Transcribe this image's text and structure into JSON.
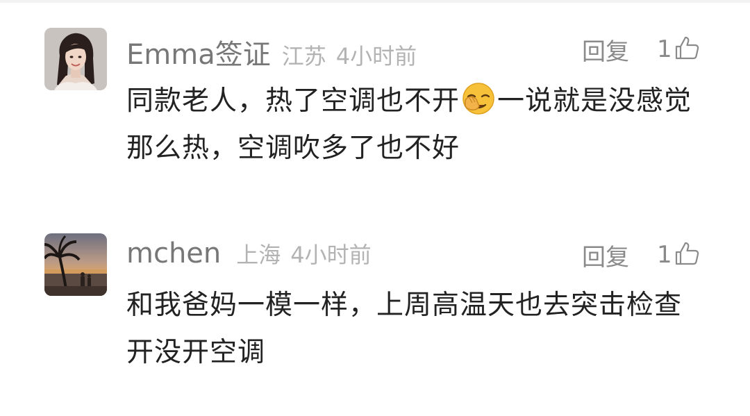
{
  "comments": [
    {
      "username": "Emma签证",
      "location": "江苏",
      "time": "4小时前",
      "reply_label": "回复",
      "likes": "1",
      "text_before_emoji": "同款老人，热了空调也不开",
      "emoji_icon": "face-palm-emoji-icon",
      "text_after_emoji": "一说就是没感觉那么热，空调吹多了也不好"
    },
    {
      "username": "mchen",
      "location": "上海",
      "time": "4小时前",
      "reply_label": "回复",
      "likes": "1",
      "text": "和我爸妈一模一样，上周高温天也去突击检查开没开空调"
    }
  ],
  "icons": {
    "like": "thumbs-up-icon",
    "avatar_1": "woman-portrait-avatar",
    "avatar_2": "palm-tree-sunset-avatar"
  },
  "colors": {
    "username": "#777777",
    "meta": "#b3b3b3",
    "body": "#222222",
    "actions": "#8a8a8a"
  }
}
